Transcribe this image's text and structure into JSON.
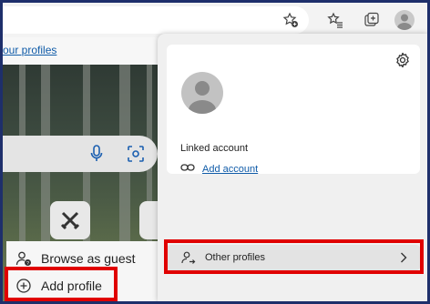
{
  "toolbar": {
    "icons": [
      "favorite-add-icon",
      "favorites-icon",
      "collections-icon",
      "profile-avatar-icon"
    ]
  },
  "page": {
    "profiles_link": "our profiles"
  },
  "profile_menu": {
    "items": [
      {
        "label": "Browse as guest",
        "icon": "guest-icon"
      },
      {
        "label": "Add profile",
        "icon": "plus-circle-icon"
      }
    ]
  },
  "panel": {
    "linked_account_label": "Linked account",
    "add_account_label": "Add account",
    "other_profiles_label": "Other profiles"
  },
  "colors": {
    "highlight": "#e00000",
    "link": "#0f5ba8",
    "frame_border": "#1e2f6b"
  }
}
